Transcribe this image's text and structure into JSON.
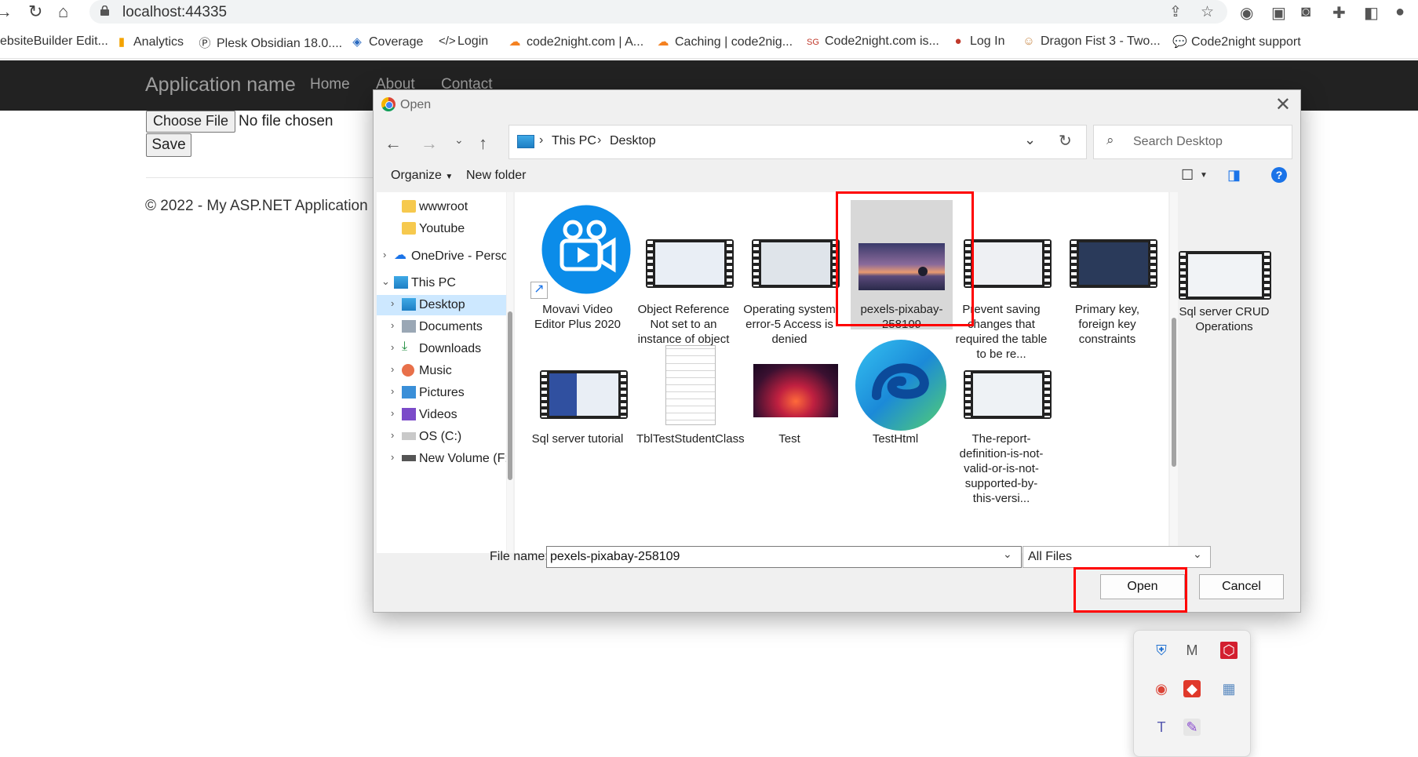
{
  "browser": {
    "url": "localhost:44335",
    "bookmarks": [
      "ebsiteBuilder Edit...",
      "Analytics",
      "Plesk Obsidian 18.0....",
      "Coverage",
      "Login",
      "code2night.com | A...",
      "Caching | code2nig...",
      "Code2night.com is...",
      "Log In",
      "Dragon Fist 3 - Two...",
      "Code2night support"
    ]
  },
  "app": {
    "brand": "Application name",
    "nav": [
      "Home",
      "About",
      "Contact"
    ],
    "choose_file": "Choose File",
    "no_file": "No file chosen",
    "save": "Save",
    "footer": "© 2022 - My ASP.NET Application"
  },
  "dialog": {
    "title": "Open",
    "breadcrumb": [
      "This PC",
      "Desktop"
    ],
    "search_placeholder": "Search Desktop",
    "organize": "Organize",
    "new_folder": "New folder",
    "nav_items": [
      {
        "label": "wwwroot"
      },
      {
        "label": "Youtube"
      },
      {
        "label": "OneDrive - Person"
      },
      {
        "label": "This PC"
      },
      {
        "label": "Desktop"
      },
      {
        "label": "Documents"
      },
      {
        "label": "Downloads"
      },
      {
        "label": "Music"
      },
      {
        "label": "Pictures"
      },
      {
        "label": "Videos"
      },
      {
        "label": "OS (C:)"
      },
      {
        "label": "New Volume (F:)"
      }
    ],
    "files": [
      {
        "label": "Movavi Video Editor Plus 2020"
      },
      {
        "label": "Object Reference Not set to an instance of object"
      },
      {
        "label": "Operating system error-5 Access is denied"
      },
      {
        "label": "pexels-pixabay-258109"
      },
      {
        "label": "Prevent saving changes that required the table to be re..."
      },
      {
        "label": "Primary key, foreign key constraints"
      },
      {
        "label": "Sql server CRUD Operations"
      },
      {
        "label": "Sql server tutorial"
      },
      {
        "label": "TblTestStudentClass"
      },
      {
        "label": "Test"
      },
      {
        "label": "TestHtml"
      },
      {
        "label": "The-report-definition-is-not-valid-or-is-not-supported-by-this-versi..."
      }
    ],
    "file_name_label": "File name:",
    "file_name_value": "pexels-pixabay-258109",
    "file_type": "All Files",
    "open": "Open",
    "cancel": "Cancel"
  },
  "colors": {
    "highlight": "#ff0000",
    "navbar": "#222222",
    "selection": "#cde8ff"
  }
}
